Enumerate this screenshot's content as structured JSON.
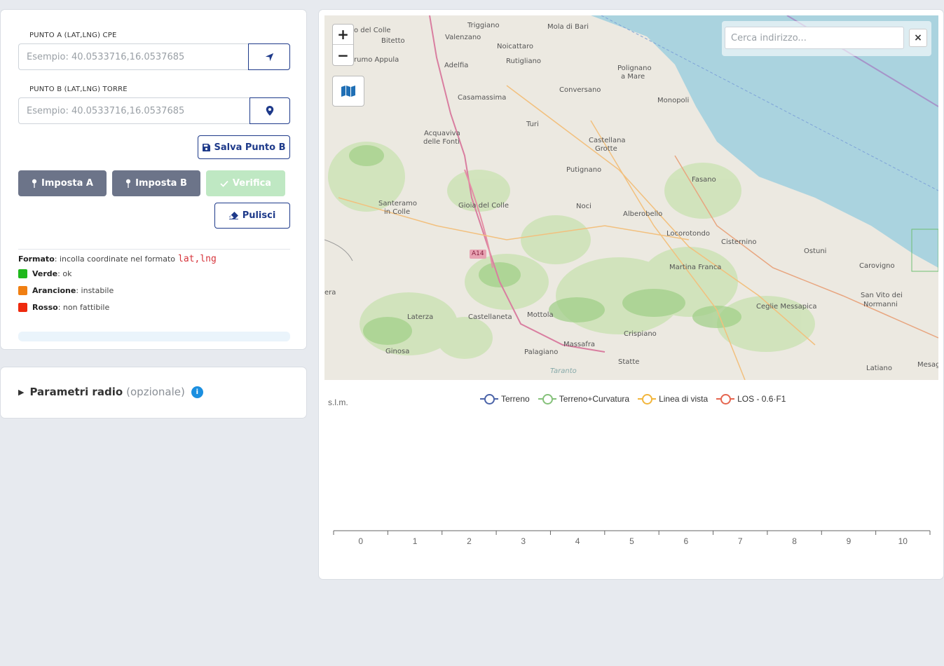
{
  "point_a": {
    "label": "PUNTO A (LAT,LNG) CPE",
    "placeholder": "Esempio: 40.0533716,16.0537685",
    "button_icon": "location-arrow-icon"
  },
  "point_b": {
    "label": "PUNTO B (LAT,LNG) TORRE",
    "placeholder": "Esempio: 40.0533716,16.0537685",
    "button_icon": "map-marker-icon"
  },
  "buttons": {
    "save_b": "Salva Punto B",
    "set_a": "Imposta A",
    "set_b": "Imposta B",
    "verify": "Verifica",
    "clear": "Pulisci"
  },
  "format_help": {
    "label": "Formato",
    "text": ": incolla coordinate nel formato",
    "code": "lat,lng"
  },
  "status_legend": [
    {
      "name": "Verde",
      "desc": ": ok",
      "color": "#1fb81c"
    },
    {
      "name": "Arancione",
      "desc": ": instabile",
      "color": "#f07f12"
    },
    {
      "name": "Rosso",
      "desc": ": non fattibile",
      "color": "#ee2a0e"
    }
  ],
  "radio_params": {
    "title": "Parametri radio",
    "optional": "(opzionale)",
    "info": "i"
  },
  "map": {
    "zoom_in": "+",
    "zoom_out": "−",
    "search_placeholder": "Cerca indirizzo...",
    "close": "×",
    "places": [
      "o del Colle",
      "Triggiano",
      "Mola di Bari",
      "Bitetto",
      "Valenzano",
      "Noicattaro",
      "rumo Appula",
      "Adelfia",
      "Rutigliano",
      "Polignano",
      "a Mare",
      "Casamassima",
      "Conversano",
      "Monopoli",
      "Turi",
      "Acquaviva",
      "delle Fonti",
      "Castellana",
      "Grotte",
      "Putignano",
      "Fasano",
      "Santeramo",
      "in Colle",
      "Gioia del Colle",
      "Noci",
      "Alberobello",
      "Locorotondo",
      "Cisternino",
      "Ostuni",
      "Carovigno",
      "A14",
      "Martina Franca",
      "era",
      "Ceglie Messapica",
      "San Vito dei",
      "Normanni",
      "Laterza",
      "Castellaneta",
      "Mottola",
      "Crispiano",
      "Ginosa",
      "Palagiano",
      "Massafra",
      "Statte",
      "Taranto",
      "Latiano",
      "Mesag"
    ]
  },
  "chart_data": {
    "type": "line",
    "ylabel": "s.l.m.",
    "x_ticks": [
      "0",
      "1",
      "2",
      "3",
      "4",
      "5",
      "6",
      "7",
      "8",
      "9",
      "10"
    ],
    "xlim": [
      0,
      11
    ],
    "series": [
      {
        "name": "Terreno",
        "color": "#4a63a8",
        "values": []
      },
      {
        "name": "Terreno+Curvatura",
        "color": "#85c17a",
        "values": []
      },
      {
        "name": "Linea di vista",
        "color": "#f2b63c",
        "values": []
      },
      {
        "name": "LOS - 0.6·F1",
        "color": "#e5654f",
        "values": []
      }
    ],
    "legend_position": "top-center"
  }
}
